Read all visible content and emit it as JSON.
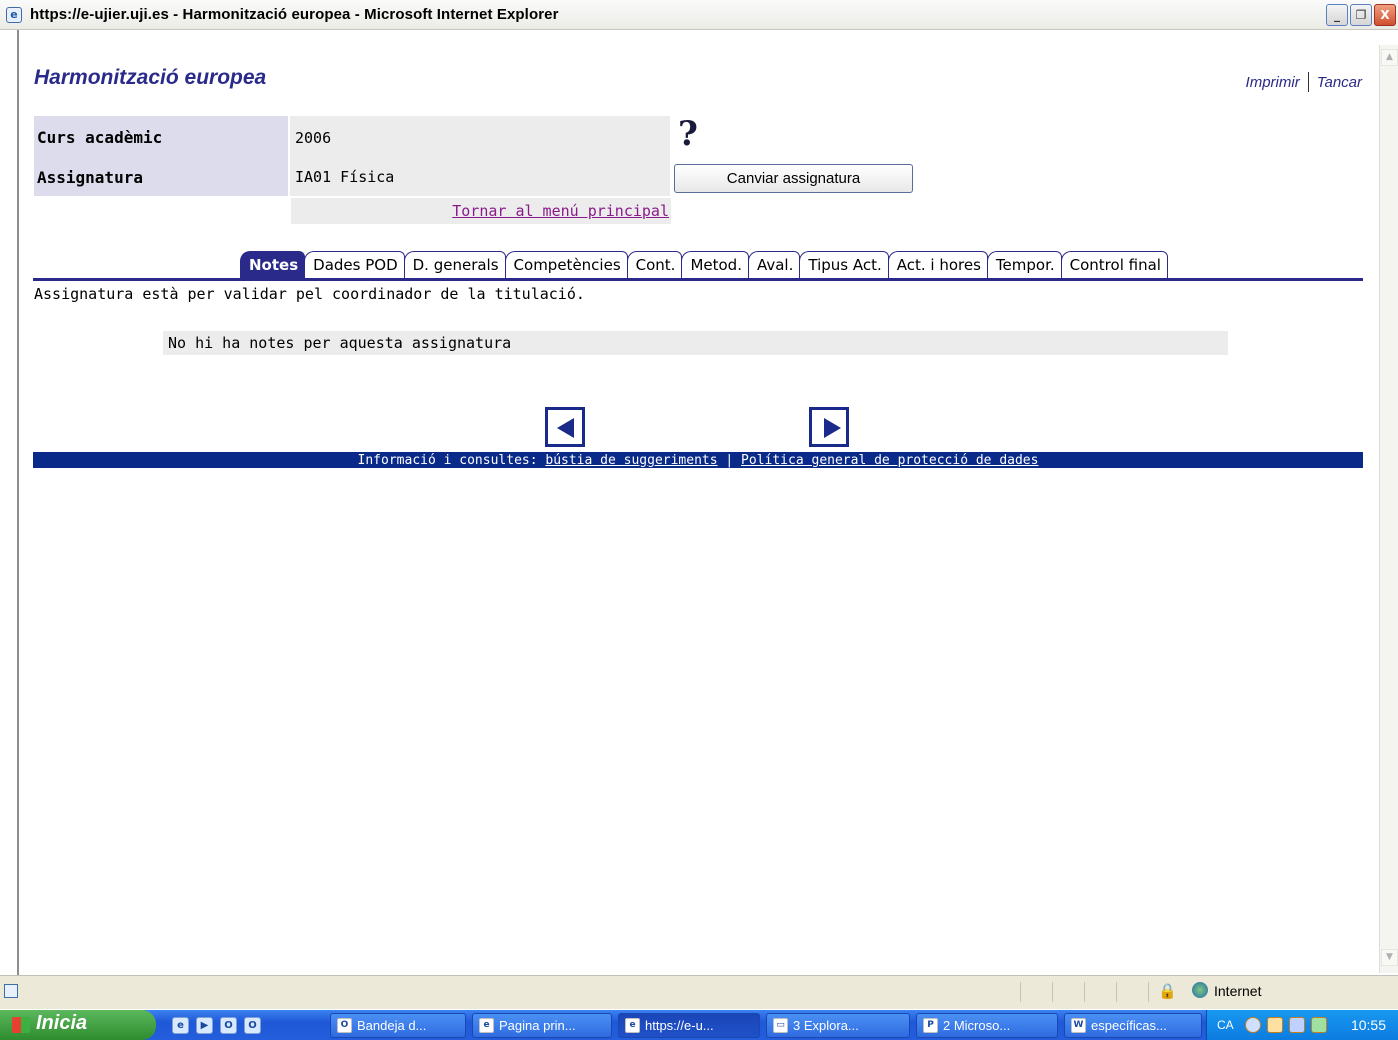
{
  "window": {
    "title": "https://e-ujier.uji.es - Harmonització europea - Microsoft Internet Explorer",
    "minimize": "_",
    "restore": "❐",
    "close": "X"
  },
  "header": {
    "title": "Harmonització europea",
    "print_label": "Imprimir",
    "close_label": "Tancar"
  },
  "info": {
    "year_label": "Curs acadèmic",
    "year_value": "2006",
    "subject_label": "Assignatura",
    "subject_value": "IA01 Física",
    "help_symbol": "?",
    "change_button": "Canviar assignatura",
    "back_link": "Tornar al menú principal"
  },
  "tabs": [
    {
      "label": "Notes",
      "active": true
    },
    {
      "label": "Dades POD",
      "active": false
    },
    {
      "label": "D. generals",
      "active": false
    },
    {
      "label": "Competències",
      "active": false
    },
    {
      "label": "Cont.",
      "active": false
    },
    {
      "label": "Metod.",
      "active": false
    },
    {
      "label": "Aval.",
      "active": false
    },
    {
      "label": "Tipus Act.",
      "active": false
    },
    {
      "label": "Act. i hores",
      "active": false
    },
    {
      "label": "Tempor.",
      "active": false
    },
    {
      "label": "Control final",
      "active": false
    }
  ],
  "main": {
    "status_message": "Assignatura està per validar pel coordinador de la titulació.",
    "notes_message": "No hi ha notes per aquesta assignatura"
  },
  "footer": {
    "prefix": "Informació i consultes: ",
    "suggestions_link": "bústia de suggeriments",
    "separator": " | ",
    "privacy_link": "Política general de protecció de dades"
  },
  "statusbar": {
    "zone": "Internet"
  },
  "taskbar": {
    "start_label": "Inicia",
    "tasks": [
      {
        "label": "Bandeja d...",
        "icon": "outlook-icon"
      },
      {
        "label": "Pagina prin...",
        "icon": "ie-icon"
      },
      {
        "label": "https://e-u...",
        "icon": "ie-icon"
      },
      {
        "label": "3 Explora...",
        "icon": "folder-icon"
      },
      {
        "label": "2 Microso...",
        "icon": "powerpoint-icon"
      },
      {
        "label": "específicas...",
        "icon": "word-icon"
      }
    ],
    "lang": "CA",
    "clock": "10:55"
  },
  "colors": {
    "accent": "#2a2a8a",
    "footer_bg": "#0a2a8a",
    "link_visited": "#8a1a8a",
    "label_bg": "#dcdcec",
    "value_bg": "#ececec"
  }
}
